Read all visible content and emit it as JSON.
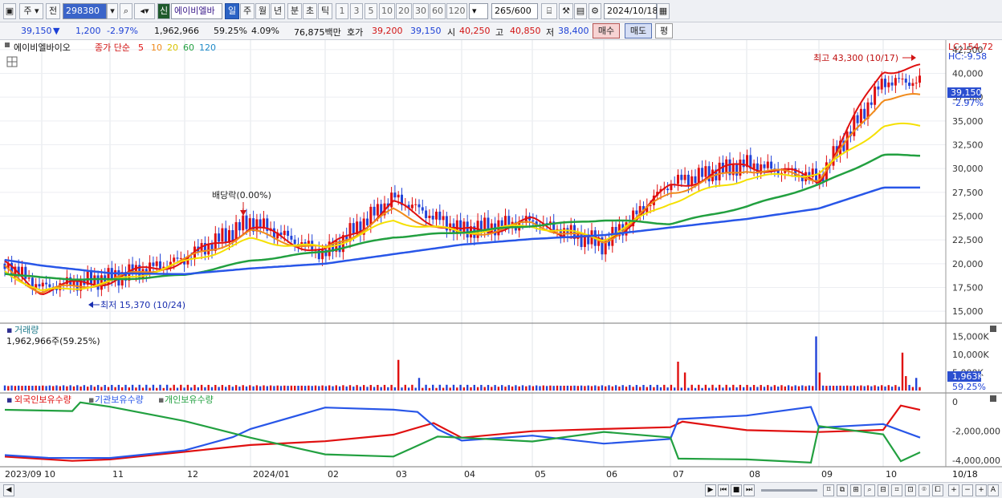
{
  "toolbar": {
    "market_btn": "주",
    "prev_btn": "전",
    "stock_code": "298380",
    "new_badge": "신",
    "stock_name": "에이비엘바",
    "periods": [
      "일",
      "주",
      "월",
      "년",
      "분",
      "초",
      "틱"
    ],
    "selected_period": "일",
    "intervals": [
      "1",
      "3",
      "5",
      "10",
      "20",
      "30",
      "60",
      "120"
    ],
    "count": "265",
    "count_max": "/600",
    "date": "2024/10/18"
  },
  "infobar": {
    "price": "39,150",
    "change": "1,200",
    "change_pct": "-2.97%",
    "volume": "1,962,966",
    "vol_ratio": "59.25%",
    "turnover": "4.09%",
    "amount": "76,875백만",
    "quote_label": "호가",
    "ask": "39,200",
    "bid": "39,150",
    "open_label": "시",
    "open": "40,250",
    "high_label": "고",
    "high": "40,850",
    "low_label": "저",
    "low": "38,400",
    "buy_btn": "매수",
    "sell_btn": "매도",
    "eval_btn": "평"
  },
  "price_panel": {
    "title": "에이비엘바이오",
    "legend_main": "종가 단순",
    "ma_periods": [
      "5",
      "10",
      "20",
      "60",
      "120"
    ],
    "ma_colors": [
      "#e01010",
      "#f08a1a",
      "#f5e000",
      "#22a040",
      "#2856e8"
    ],
    "lc_label": "LC:154.72",
    "hc_label": "HC:-9.58",
    "price_tag": "39,150",
    "pct_tag": "-2.97%",
    "high_note": "최고 43,300 (10/17)",
    "low_note": "최저 15,370 (10/24)",
    "dividend_note": "배당락(0.00%)",
    "y_ticks": [
      "42,500",
      "40,000",
      "37,500",
      "35,000",
      "32,500",
      "30,000",
      "27,500",
      "25,000",
      "22,500",
      "20,000",
      "17,500",
      "15,000"
    ]
  },
  "volume_panel": {
    "title": "거래량",
    "value": "1,962,966주(59.25%)",
    "y_ticks": [
      "15,000K",
      "10,000K",
      "5,000K"
    ],
    "tag": "1,963K",
    "tag_pct": "59.25%"
  },
  "holdings_panel": {
    "legend": [
      "외국인보유수량",
      "기관보유수량",
      "개인보유수량"
    ],
    "legend_colors": [
      "#e01010",
      "#2856e8",
      "#22a040"
    ],
    "y_ticks": [
      "0",
      "-2,000,000",
      "-4,000,000"
    ]
  },
  "x_axis": {
    "labels": [
      "2023/09",
      "10",
      "11",
      "12",
      "2024/01",
      "02",
      "03",
      "04",
      "05",
      "06",
      "07",
      "08",
      "09",
      "10"
    ],
    "end_label": "10/18"
  },
  "chart_data": {
    "type": "line",
    "x": [
      "2023/09",
      "2023/10",
      "2023/11",
      "2023/12",
      "2024/01",
      "2024/02",
      "2024/03",
      "2024/04",
      "2024/05",
      "2024/06",
      "2024/07",
      "2024/08",
      "2024/09",
      "2024/10"
    ],
    "series": [
      {
        "name": "종가",
        "values": [
          20000,
          17500,
          18500,
          20500,
          24500,
          21000,
          27000,
          23500,
          24500,
          22000,
          28500,
          30500,
          29000,
          39150
        ]
      },
      {
        "name": "5",
        "values": [
          19800,
          17200,
          18300,
          20400,
          23800,
          21200,
          26200,
          23200,
          24400,
          22000,
          28000,
          30500,
          28800,
          40500
        ]
      },
      {
        "name": "10",
        "values": [
          19600,
          17000,
          18200,
          20300,
          23300,
          21400,
          25500,
          23000,
          24200,
          22200,
          27500,
          30000,
          29000,
          37500
        ]
      },
      {
        "name": "20",
        "values": [
          19300,
          17000,
          18000,
          20100,
          22500,
          21600,
          24500,
          23300,
          24000,
          22600,
          26500,
          29000,
          29500,
          34500
        ]
      },
      {
        "name": "60",
        "values": [
          19000,
          18500,
          18300,
          18800,
          20300,
          21300,
          22800,
          23300,
          24000,
          24600,
          24200,
          26000,
          28300,
          31400
        ]
      },
      {
        "name": "120",
        "values": [
          20400,
          19800,
          19000,
          18900,
          19500,
          20000,
          21000,
          22000,
          22600,
          23000,
          23800,
          24700,
          25800,
          28000
        ]
      }
    ],
    "ylim": [
      14000,
      43500
    ]
  }
}
